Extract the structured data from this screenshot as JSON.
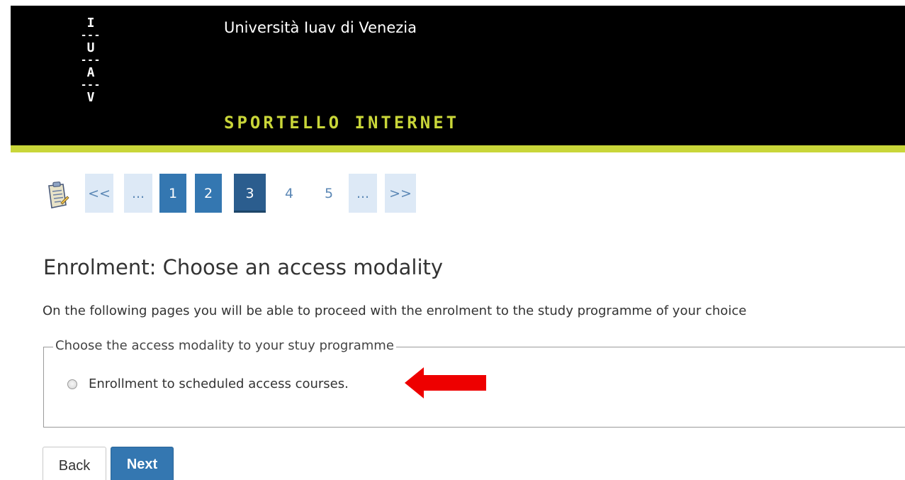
{
  "header": {
    "logo_letters": [
      "I",
      "U",
      "A",
      "V"
    ],
    "logo_separator": "---",
    "university_name": "Università Iuav di Venezia",
    "portal_name": "SPORTELLO INTERNET"
  },
  "steps": {
    "items": [
      "<<",
      "...",
      "1",
      "2",
      "3",
      "4",
      "5",
      "...",
      ">>"
    ],
    "current": "3"
  },
  "main": {
    "title": "Enrolment: Choose an access modality",
    "intro": "On the following pages you will be able to proceed with the enrolment to the study programme of your choice",
    "fieldset_legend": "Choose the access modality to your stuy programme",
    "option_label": "Enrollment to scheduled access courses."
  },
  "buttons": {
    "back": "Back",
    "next": "Next"
  },
  "colors": {
    "header_bg": "#000000",
    "accent": "#c9d639",
    "step_light": "#dde9f6",
    "step_dark": "#3477b1",
    "step_current": "#2b5d8e",
    "arrow": "#ee0000"
  },
  "icons": {
    "steps_icon": "clipboard-icon",
    "annotation": "red-arrow-icon"
  }
}
